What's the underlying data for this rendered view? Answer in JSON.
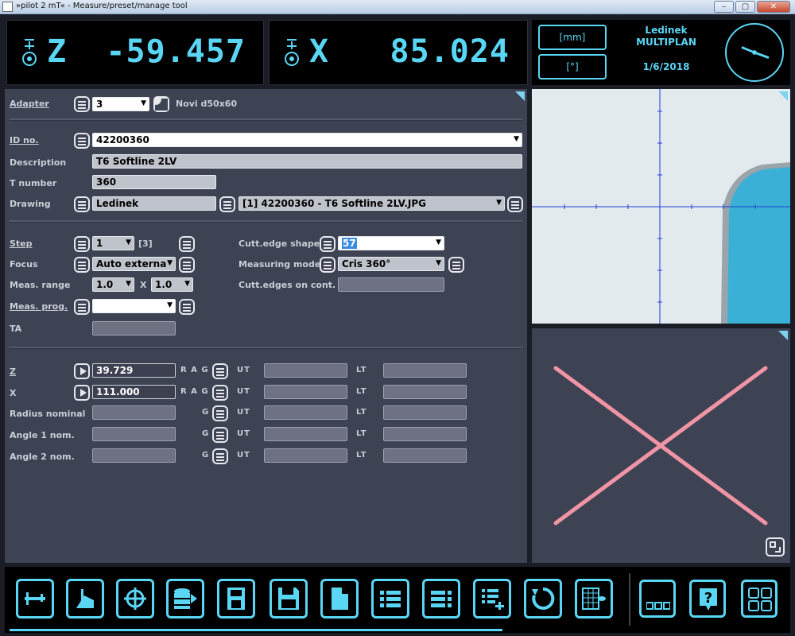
{
  "window": {
    "title": "»pilot 2 mT« - Measure/preset/manage tool",
    "min": "–",
    "max": "▢",
    "close": "✕"
  },
  "readouts": [
    {
      "axis": "Z",
      "value": "-59.457"
    },
    {
      "axis": "X",
      "value": "85.024"
    }
  ],
  "info": {
    "unit_mm": "[mm]",
    "unit_deg": "[°]",
    "company": "Ledinek",
    "product": "MULTIPLAN",
    "date": "1/6/2018"
  },
  "form": {
    "adapter": {
      "label": "Adapter",
      "value": "3",
      "name": "Novi d50x60"
    },
    "id_no": {
      "label": "ID no.",
      "value": "42200360"
    },
    "description": {
      "label": "Description",
      "value": "T6 Softline 2LV"
    },
    "t_number": {
      "label": "T number",
      "value": "360"
    },
    "drawing": {
      "label": "Drawing",
      "value": "Ledinek",
      "file": "[1] 42200360 - T6 Softline 2LV.JPG"
    },
    "step": {
      "label": "Step",
      "value": "1",
      "count": "[3]"
    },
    "focus": {
      "label": "Focus",
      "value": "Auto externa"
    },
    "meas_range": {
      "label": "Meas. range",
      "value1": "1.0",
      "x": "X",
      "value2": "1.0"
    },
    "meas_prog": {
      "label": "Meas. prog.",
      "value": ""
    },
    "ta": {
      "label": "TA",
      "value": ""
    },
    "cutt_edge_shape": {
      "label": "Cutt.edge shape",
      "value": "57"
    },
    "measuring_mode": {
      "label": "Measuring mode",
      "value": "Cris 360°"
    },
    "cutt_edges_on_cont": {
      "label": "Cutt.edges on cont.",
      "value": ""
    },
    "tolerances": [
      {
        "label": "Z",
        "value": "39.729",
        "flags": "R A G",
        "ut": "UT",
        "lt": "LT"
      },
      {
        "label": "X",
        "value": "111.000",
        "flags": "R A G",
        "ut": "UT",
        "lt": "LT"
      },
      {
        "label": "Radius nominal",
        "value": "",
        "flags": "G",
        "ut": "UT",
        "lt": "LT"
      },
      {
        "label": "Angle 1 nom.",
        "value": "",
        "flags": "G",
        "ut": "UT",
        "lt": "LT"
      },
      {
        "label": "Angle 2 nom.",
        "value": "",
        "flags": "G",
        "ut": "UT",
        "lt": "LT"
      }
    ]
  },
  "toolbar": [
    "caliper-icon",
    "measure-height-icon",
    "crosshair-icon",
    "database-export-icon",
    "zx-device-icon",
    "save-icon",
    "new-document-icon",
    "list-icon",
    "list-menu-icon",
    "list-add-icon",
    "refresh-icon",
    "table-view-icon",
    "more-icon",
    "help-icon",
    "grid-icon"
  ],
  "colors": {
    "accent": "#5ad6f5",
    "panel": "#3e4354",
    "pink": "#f195a6"
  }
}
